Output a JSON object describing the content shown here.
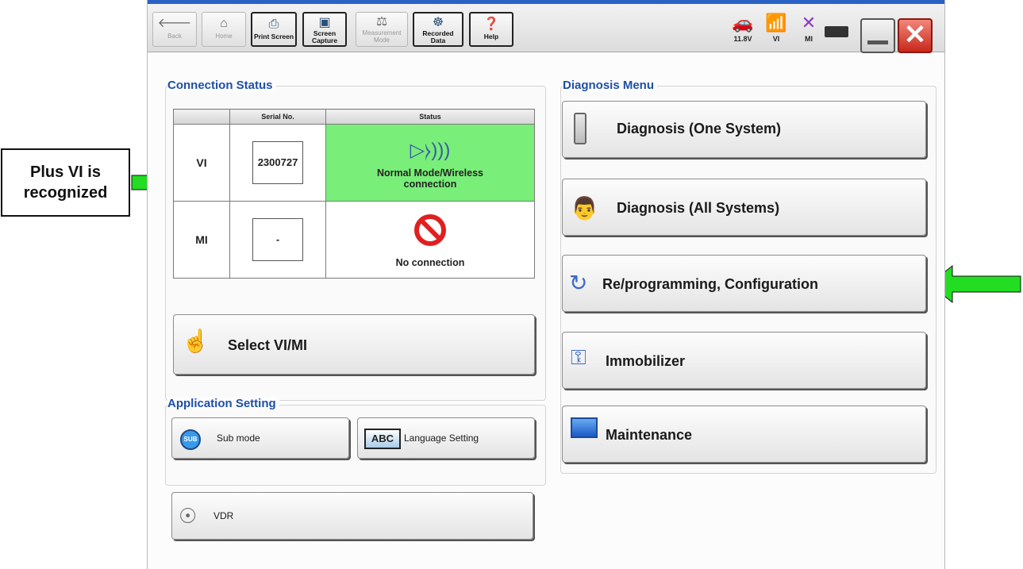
{
  "toolbar": {
    "back": "Back",
    "home": "Home",
    "print_screen": "Print Screen",
    "screen_capture": "Screen\nCapture",
    "measurement_mode": "Measurement\nMode",
    "recorded_data": "Recorded\nData",
    "help": "Help",
    "voltage": "11.8V",
    "vi_label": "VI",
    "mi_label": "MI"
  },
  "connection_status": {
    "title": "Connection Status",
    "col_serial": "Serial No.",
    "col_status": "Status",
    "rows": [
      {
        "label": "VI",
        "serial": "2300727",
        "status": "Normal Mode/Wireless connection"
      },
      {
        "label": "MI",
        "serial": "-",
        "status": "No connection"
      }
    ],
    "select_button": "Select VI/MI"
  },
  "application_setting": {
    "title": "Application Setting",
    "sub_mode": "Sub mode",
    "sub_badge": "SUB",
    "language": "Language Setting",
    "abc_badge": "ABC",
    "vdr": "VDR"
  },
  "diagnosis_menu": {
    "title": "Diagnosis Menu",
    "one_system": "Diagnosis (One System)",
    "all_systems": "Diagnosis (All Systems)",
    "reprogramming": "Re/programming, Configuration",
    "immobilizer": "Immobilizer",
    "maintenance": "Maintenance"
  },
  "annotation": {
    "line1": "Plus VI is",
    "line2": "recognized"
  },
  "colors": {
    "accent_title": "#1e4fa8",
    "status_ok": "#79ee79",
    "arrow": "#22dd22"
  }
}
